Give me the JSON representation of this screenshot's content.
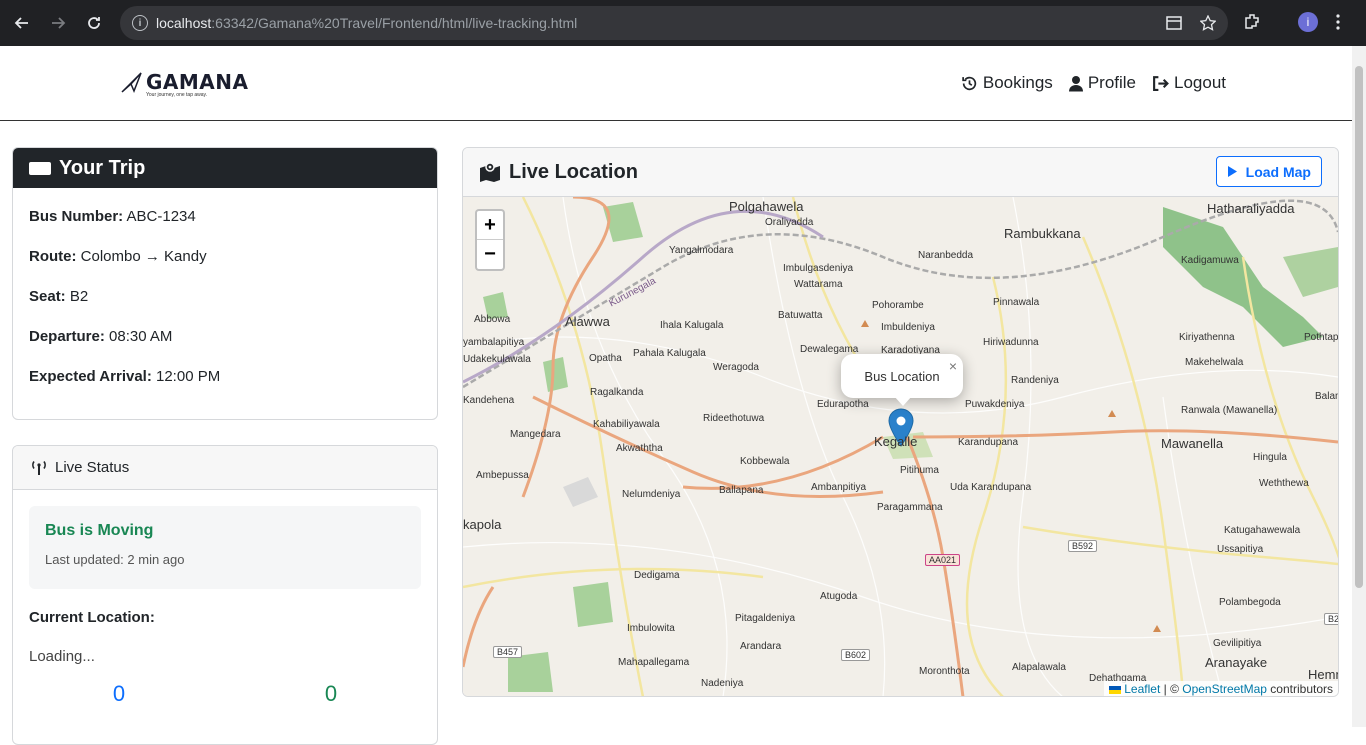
{
  "browser": {
    "url_host": "localhost",
    "url_path": ":63342/Gamana%20Travel/Frontend/html/live-tracking.html",
    "avatar_letter": "i"
  },
  "header": {
    "logo_text": "GAMANA",
    "logo_tagline": "Your journey, one tap away.",
    "nav": [
      {
        "label": "Bookings",
        "icon": "history-icon"
      },
      {
        "label": "Profile",
        "icon": "user-icon"
      },
      {
        "label": "Logout",
        "icon": "logout-icon"
      }
    ]
  },
  "trip": {
    "title": "Your Trip",
    "fields": [
      {
        "label": "Bus Number:",
        "value": "ABC-1234"
      },
      {
        "label": "Route:",
        "value": "Colombo → Kandy"
      },
      {
        "label": "Seat:",
        "value": "B2"
      },
      {
        "label": "Departure:",
        "value": "08:30 AM"
      },
      {
        "label": "Expected Arrival:",
        "value": "12:00 PM"
      }
    ]
  },
  "status": {
    "title": "Live Status",
    "state": "Bus is Moving",
    "updated": "Last updated: 2 min ago",
    "current_location_label": "Current Location:",
    "current_location_value": "Loading...",
    "counter_1": "0",
    "counter_2": "0"
  },
  "map": {
    "title": "Live Location",
    "load_button": "Load Map",
    "zoom_in": "+",
    "zoom_out": "−",
    "popup_text": "Bus Location",
    "popup_close": "×",
    "attribution_leaflet": "Leaflet",
    "attribution_sep": " | © ",
    "attribution_osm": "OpenStreetMap",
    "attribution_suffix": " contributors",
    "labels": [
      "Polgahawela",
      "Oraliyadda",
      "Yangalmodara",
      "Imbulgasdeniya",
      "Wattarama",
      "Naranbedda",
      "Rambukkana",
      "Hatharaliyadda",
      "Kadigamuwa",
      "Abbowa",
      "Alawwa",
      "Ihala Kalugala",
      "Batuwatta",
      "Pohorambe",
      "Imbuldeniya",
      "Pinnawala",
      "Kiriyathenna",
      "Pothtap",
      "yambalapitiya",
      "Udakekulawala",
      "Opatha",
      "Pahala Kalugala",
      "Dewalegama",
      "Karadotiyana",
      "Hiriwadunna",
      "Makehelwala",
      "Weragoda",
      "Randeniya",
      "Kandehena",
      "Ragalkanda",
      "Edurapotha",
      "Puwakdeniya",
      "Balana",
      "Ranwala (Mawanella)",
      "Mangedara",
      "Kahabiliyawala",
      "Rideethotuwa",
      "Kegalle",
      "Karandupana",
      "Mawanella",
      "Akwaththa",
      "Kobbewala",
      "Pitihuma",
      "Hingula",
      "Ambepussa",
      "Nelumdeniya",
      "Ballapana",
      "Ambanpitiya",
      "Uda Karandupana",
      "Weththewa",
      "kapola",
      "Paragammana",
      "Katugahawewala",
      "Ussapitiya",
      "Dedigama",
      "Atugoda",
      "Polambegoda",
      "Imbulowita",
      "Pitagaldeniya",
      "Gevilipitiya",
      "Arandara",
      "Mahapallegama",
      "Moronthota",
      "Alapalawala",
      "Aranayake",
      "Dehathgama",
      "Hemm",
      "Nadeniya",
      "Kurunegala"
    ],
    "road_badges": [
      "AA021",
      "B592",
      "B457",
      "B602",
      "B2"
    ]
  }
}
